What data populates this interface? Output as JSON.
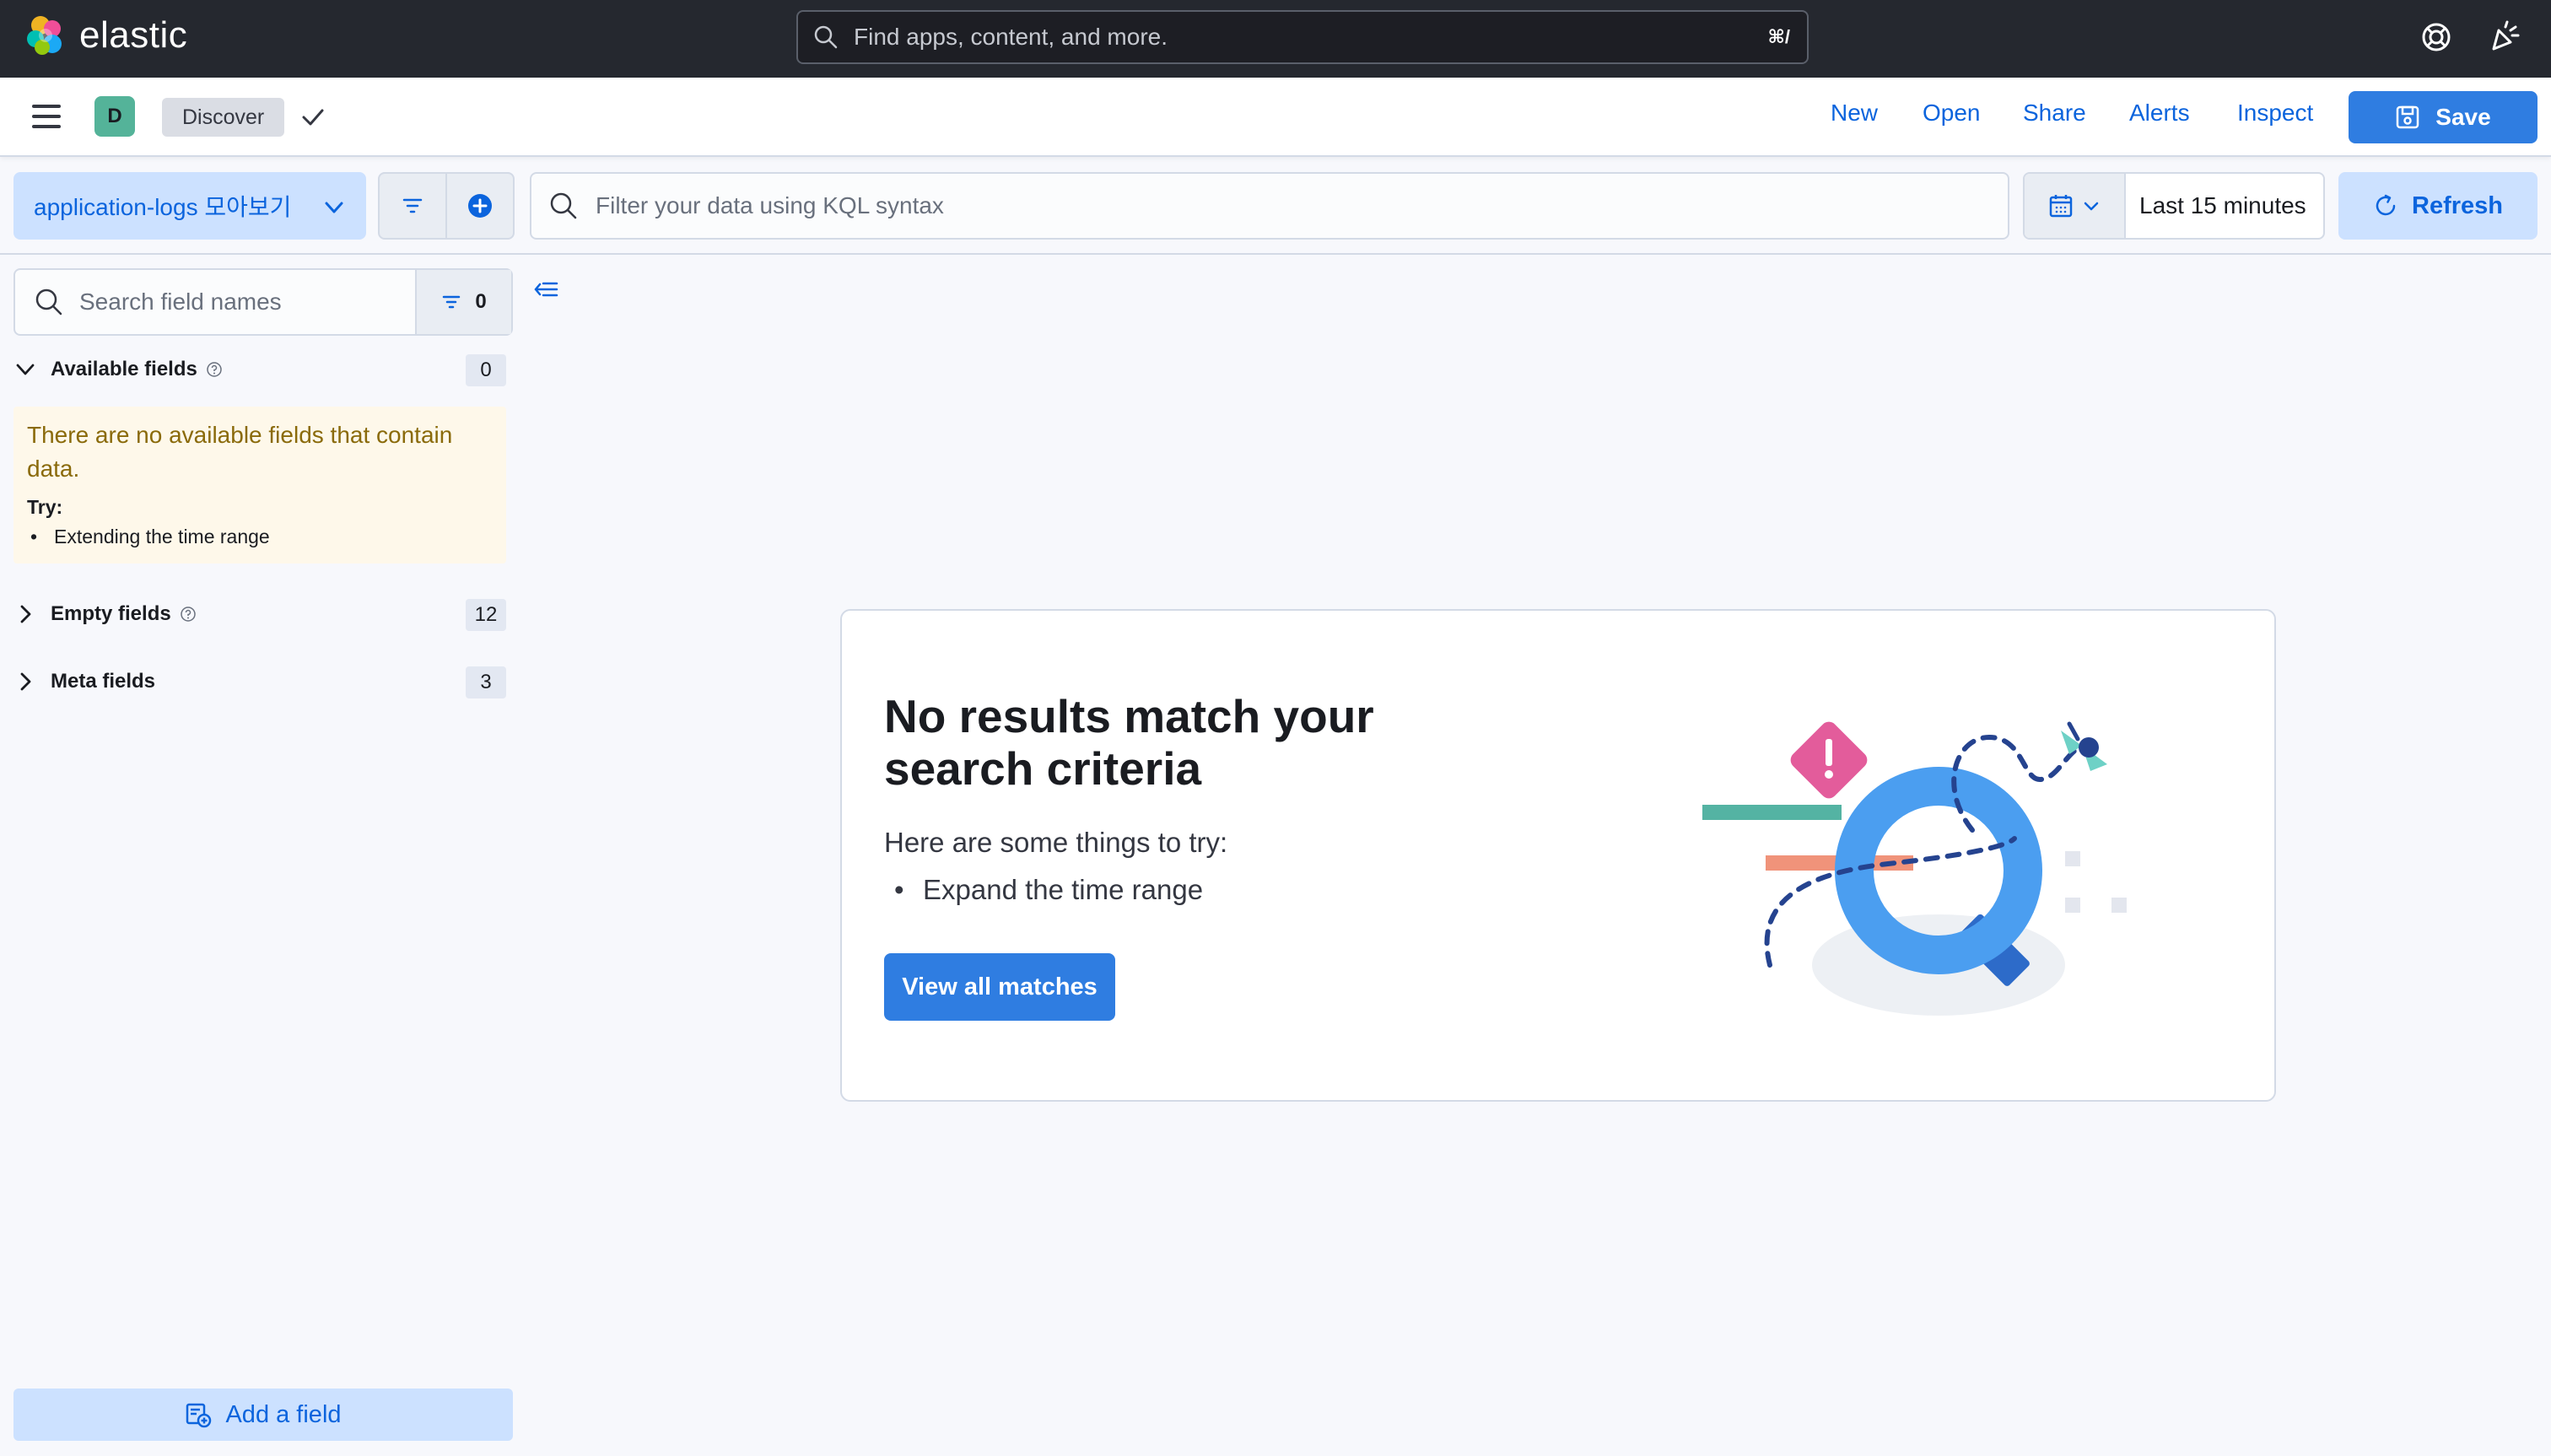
{
  "topbar": {
    "brand": "elastic",
    "search_placeholder": "Find apps, content, and more.",
    "search_shortcut": "⌘/"
  },
  "appbar": {
    "space_initial": "D",
    "breadcrumb": "Discover",
    "links": {
      "new": "New",
      "open": "Open",
      "share": "Share",
      "alerts": "Alerts",
      "inspect": "Inspect"
    },
    "save_label": "Save"
  },
  "querybar": {
    "data_view": "application-logs 모아보기",
    "kql_placeholder": "Filter your data using KQL syntax",
    "time_range": "Last 15 minutes",
    "refresh_label": "Refresh"
  },
  "sidebar": {
    "search_placeholder": "Search field names",
    "filter_count": "0",
    "available": {
      "label": "Available fields",
      "count": "0"
    },
    "callout": {
      "title": "There are no available fields that contain data.",
      "try_label": "Try:",
      "item": "Extending the time range"
    },
    "empty": {
      "label": "Empty fields",
      "count": "12"
    },
    "meta": {
      "label": "Meta fields",
      "count": "3"
    },
    "add_field_label": "Add a field"
  },
  "panel": {
    "title": "No results match your search criteria",
    "subtitle": "Here are some things to try:",
    "item": "Expand the time range",
    "button": "View all matches"
  },
  "colors": {
    "header_bg": "#25282f",
    "primary": "#2f7de1",
    "link": "#0b64dd",
    "light_blue": "#cce1ff",
    "warning_bg": "#fef8ea"
  }
}
